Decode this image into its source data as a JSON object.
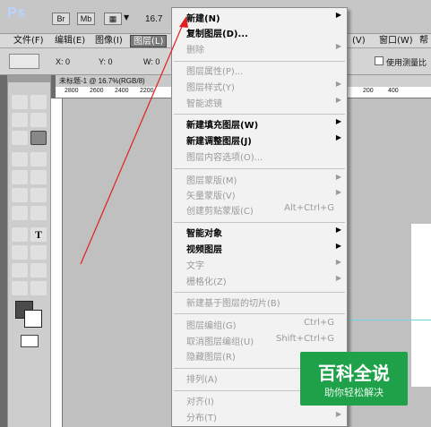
{
  "app": {
    "logo": "Ps",
    "br_label": "Br",
    "mb_label": "Mb",
    "zoom": "16.7"
  },
  "menubar": {
    "items": [
      "文件(F)",
      "编辑(E)",
      "图像(I)",
      "图层(L)",
      "(V)",
      "窗口(W)",
      "帮"
    ]
  },
  "options": {
    "x": "X: 0",
    "y": "Y: 0",
    "w": "W: 0",
    "measure_checkbox_label": "使用测量比"
  },
  "document": {
    "tab_title": "未标题-1 @ 16.7%(RGB/8)",
    "ruler_ticks": [
      "2800",
      "2600",
      "2400",
      "2200",
      "400",
      "200",
      "400"
    ]
  },
  "layer_menu": {
    "items": [
      {
        "label": "新建(N)",
        "enabled": true,
        "submenu": true
      },
      {
        "label": "复制图层(D)...",
        "enabled": true
      },
      {
        "label": "删除",
        "enabled": false,
        "submenu": true
      },
      {
        "label": "图层属性(P)...",
        "enabled": false
      },
      {
        "label": "图层样式(Y)",
        "enabled": false,
        "submenu": true
      },
      {
        "label": "智能滤镜",
        "enabled": false,
        "submenu": true
      },
      {
        "label": "新建填充图层(W)",
        "enabled": true,
        "submenu": true
      },
      {
        "label": "新建调整图层(J)",
        "enabled": true,
        "submenu": true
      },
      {
        "label": "图层内容选项(O)...",
        "enabled": false
      },
      {
        "label": "图层蒙版(M)",
        "enabled": false,
        "submenu": true
      },
      {
        "label": "矢量蒙版(V)",
        "enabled": false,
        "submenu": true
      },
      {
        "label": "创建剪贴蒙版(C)",
        "enabled": false,
        "shortcut": "Alt+Ctrl+G"
      },
      {
        "label": "智能对象",
        "enabled": true,
        "submenu": true
      },
      {
        "label": "视频图层",
        "enabled": true,
        "submenu": true
      },
      {
        "label": "文字",
        "enabled": false,
        "submenu": true
      },
      {
        "label": "栅格化(Z)",
        "enabled": false,
        "submenu": true
      },
      {
        "label": "新建基于图层的切片(B)",
        "enabled": false
      },
      {
        "label": "图层编组(G)",
        "enabled": false,
        "shortcut": "Ctrl+G"
      },
      {
        "label": "取消图层编组(U)",
        "enabled": false,
        "shortcut": "Shift+Ctrl+G"
      },
      {
        "label": "隐藏图层(R)",
        "enabled": false
      },
      {
        "label": "排列(A)",
        "enabled": false,
        "submenu": true
      },
      {
        "label": "对齐(I)",
        "enabled": false,
        "submenu": true
      },
      {
        "label": "分布(T)",
        "enabled": false,
        "submenu": true
      }
    ]
  },
  "watermark": {
    "title": "百科全说",
    "subtitle": "助你轻松解决"
  },
  "colors": {
    "annotation_arrow": "#e02020",
    "watermark_bg": "#1fa14a",
    "guide": "#6fd6e6"
  }
}
